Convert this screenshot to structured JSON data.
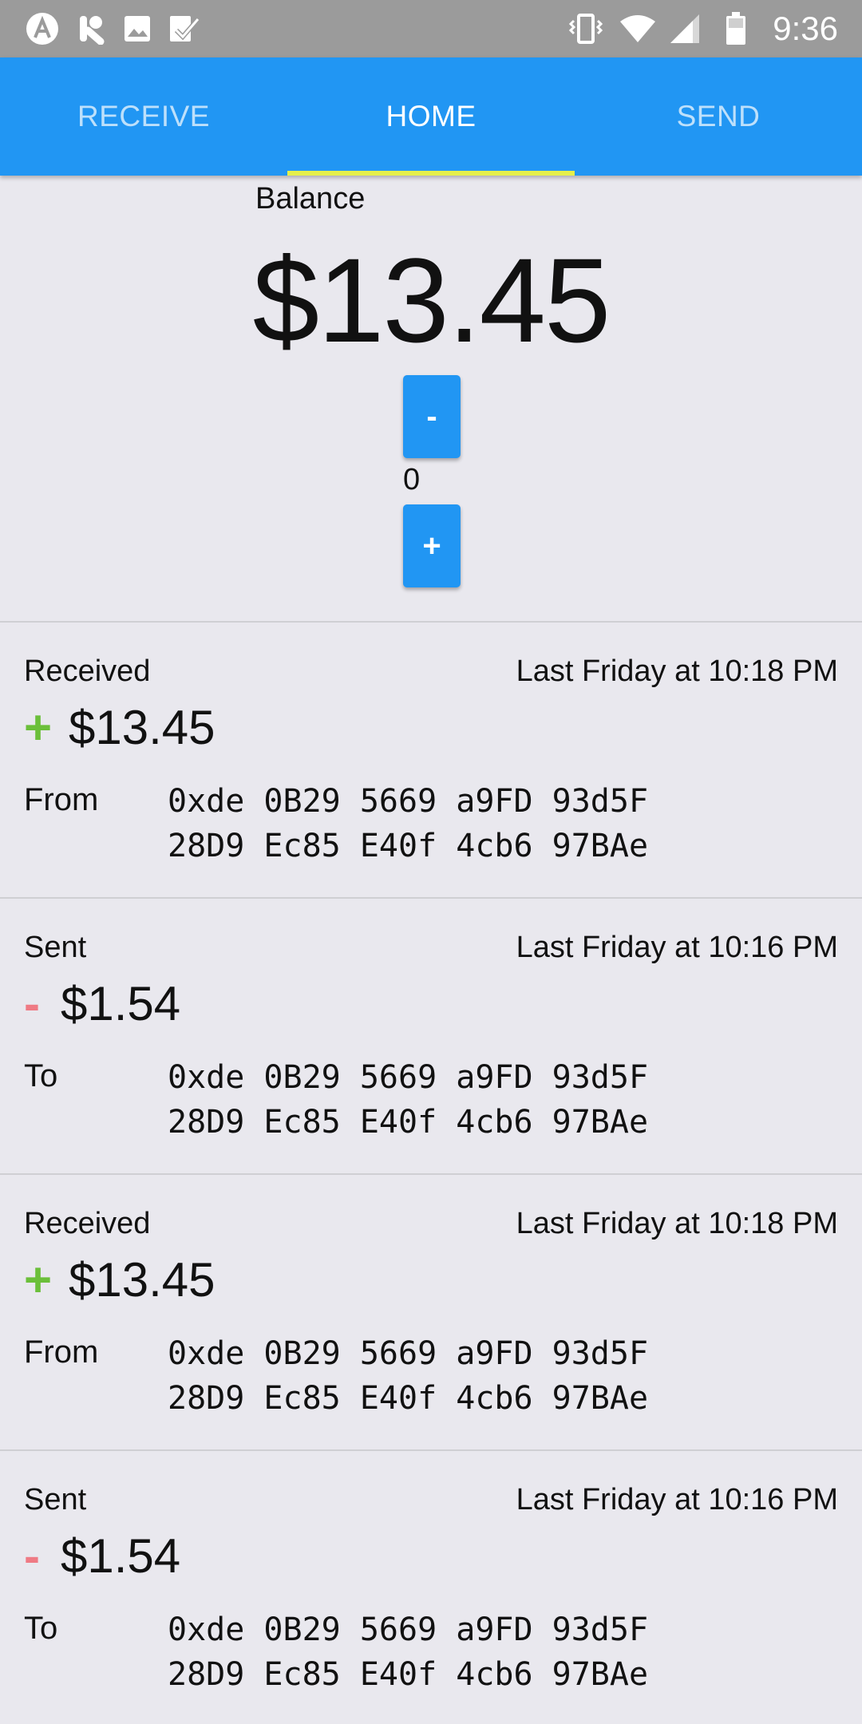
{
  "status_bar": {
    "time": "9:36",
    "left_icons": [
      "app-a-icon",
      "app-k-icon",
      "image-icon",
      "check-icon"
    ],
    "right_icons": [
      "vibrate-icon",
      "wifi-icon",
      "signal-icon",
      "battery-icon"
    ]
  },
  "tabs": [
    {
      "label": "RECEIVE"
    },
    {
      "label": "HOME"
    },
    {
      "label": "SEND"
    }
  ],
  "active_tab": "HOME",
  "colors": {
    "primary": "#2196f3",
    "indicator": "#e5f04a",
    "received": "#6bbf3a",
    "sent": "#ef7a84"
  },
  "balance": {
    "label": "Balance",
    "amount": "$13.45"
  },
  "stepper": {
    "minus": "-",
    "value": "0",
    "plus": "+"
  },
  "transactions": [
    {
      "type": "Received",
      "date": "Last Friday at 10:18 PM",
      "sign": "+",
      "amount": "$13.45",
      "direction": "From",
      "address_line1": "0xde 0B29 5669 a9FD 93d5F",
      "address_line2": "28D9 Ec85 E40f 4cb6 97BAe"
    },
    {
      "type": "Sent",
      "date": "Last Friday at 10:16 PM",
      "sign": "-",
      "amount": "$1.54",
      "direction": "To",
      "address_line1": "0xde 0B29 5669 a9FD 93d5F",
      "address_line2": "28D9 Ec85 E40f 4cb6 97BAe"
    },
    {
      "type": "Received",
      "date": "Last Friday at 10:18 PM",
      "sign": "+",
      "amount": "$13.45",
      "direction": "From",
      "address_line1": "0xde 0B29 5669 a9FD 93d5F",
      "address_line2": "28D9 Ec85 E40f 4cb6 97BAe"
    },
    {
      "type": "Sent",
      "date": "Last Friday at 10:16 PM",
      "sign": "-",
      "amount": "$1.54",
      "direction": "To",
      "address_line1": "0xde 0B29 5669 a9FD 93d5F",
      "address_line2": "28D9 Ec85 E40f 4cb6 97BAe"
    }
  ]
}
